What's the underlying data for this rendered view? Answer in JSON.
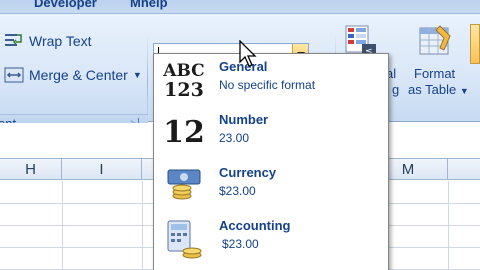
{
  "tabs": {
    "developer": "Developer",
    "help": "Mhelp"
  },
  "ribbon": {
    "wrap_text": "Wrap Text",
    "merge_center": "Merge & Center",
    "alignment_group": "ent",
    "format_combo_value": "",
    "conditional_partial_1": "al",
    "conditional_partial_2": "g",
    "format_as_table_line1": "Format",
    "format_as_table_line2": "as Table"
  },
  "columns": [
    "H",
    "I",
    "M"
  ],
  "number_format_menu": {
    "items": [
      {
        "title": "General",
        "description": "No specific format",
        "icon": "abc-123-icon",
        "icon_text_top": "ABC",
        "icon_text_bottom": "123"
      },
      {
        "title": "Number",
        "description": "23.00",
        "icon": "number-12-icon",
        "icon_text_top": "12"
      },
      {
        "title": "Currency",
        "description": "$23.00",
        "icon": "currency-icon"
      },
      {
        "title": "Accounting",
        "description": "$23.00",
        "icon": "accounting-icon"
      }
    ]
  },
  "colors": {
    "ribbon_text": "#15428b",
    "accent_orange": "#ffc85a",
    "grid_header": "#dce6f4"
  }
}
